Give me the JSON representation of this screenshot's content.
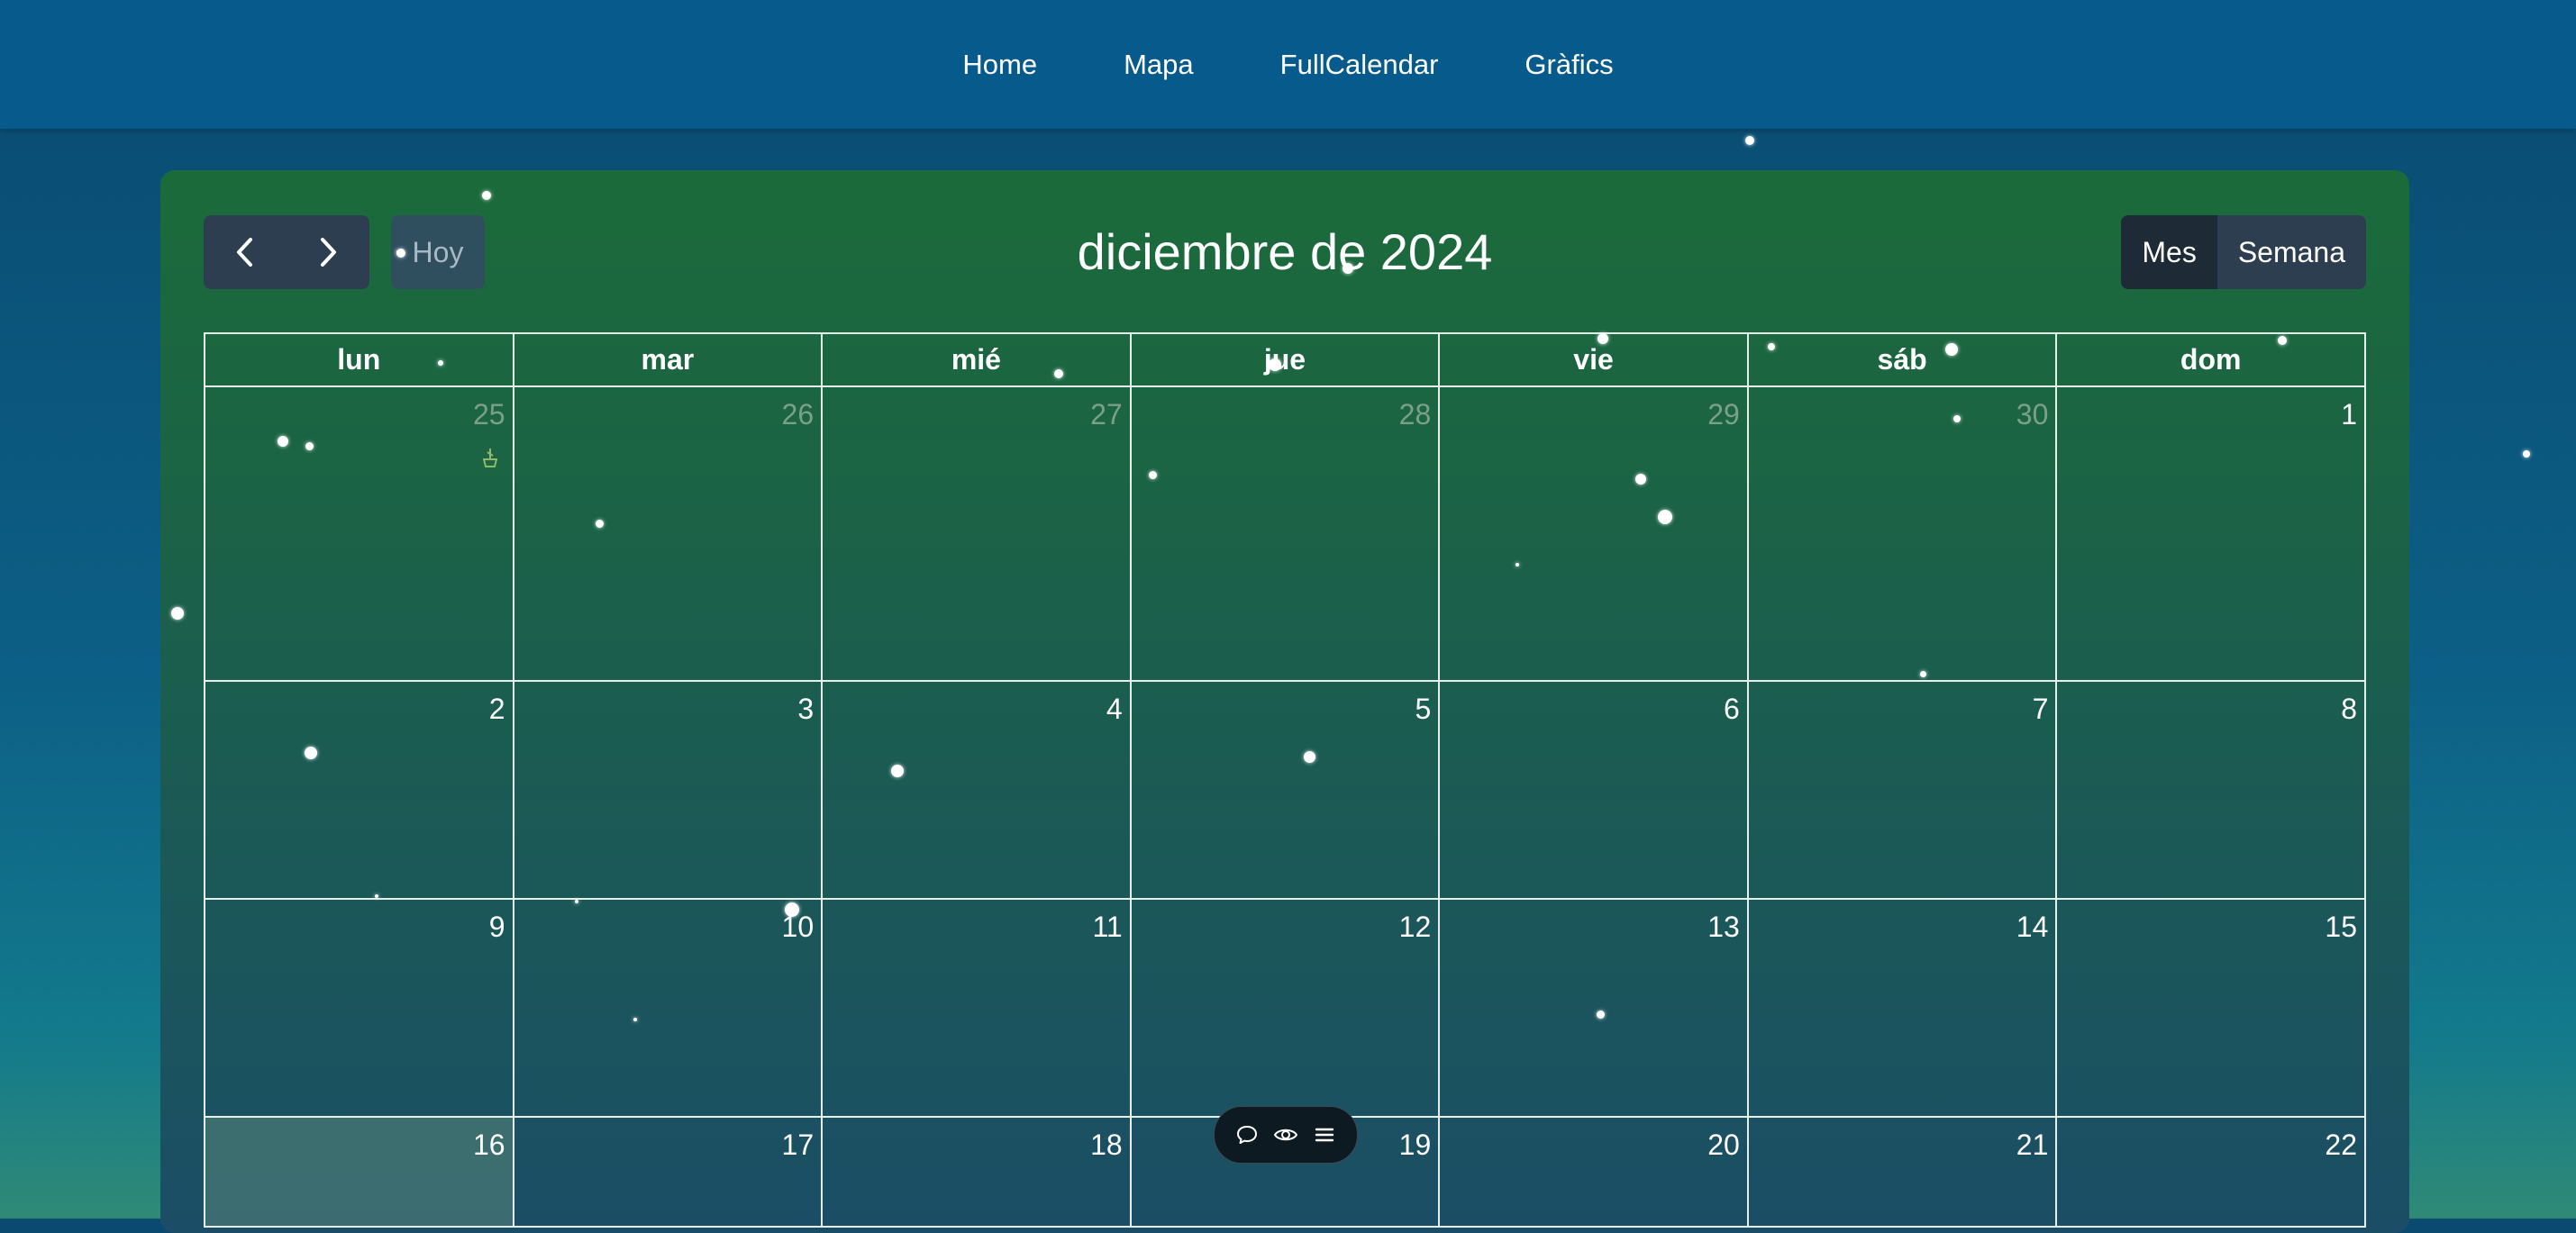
{
  "nav": {
    "links": [
      "Home",
      "Mapa",
      "FullCalendar",
      "Gràfics"
    ]
  },
  "calendar": {
    "title": "diciembre de 2024",
    "today_label": "Hoy",
    "views": [
      "Mes",
      "Semana"
    ],
    "active_view": "Mes",
    "weekdays": [
      "lun",
      "mar",
      "mié",
      "jue",
      "vie",
      "sáb",
      "dom"
    ],
    "weeks": [
      [
        "25",
        "26",
        "27",
        "28",
        "29",
        "30",
        "1"
      ],
      [
        "2",
        "3",
        "4",
        "5",
        "6",
        "7",
        "8"
      ],
      [
        "9",
        "10",
        "11",
        "12",
        "13",
        "14",
        "15"
      ],
      [
        "16",
        "17",
        "18",
        "19",
        "20",
        "21",
        "22"
      ]
    ],
    "today_day": "16"
  },
  "widget": {
    "icons": [
      "chat-icon",
      "eye-icon",
      "menu-icon"
    ]
  },
  "colors": {
    "navbar": "#065b8c",
    "panel_top": "#1b6b3a",
    "button": "#2c3e50",
    "button_active": "#1e2a36"
  }
}
